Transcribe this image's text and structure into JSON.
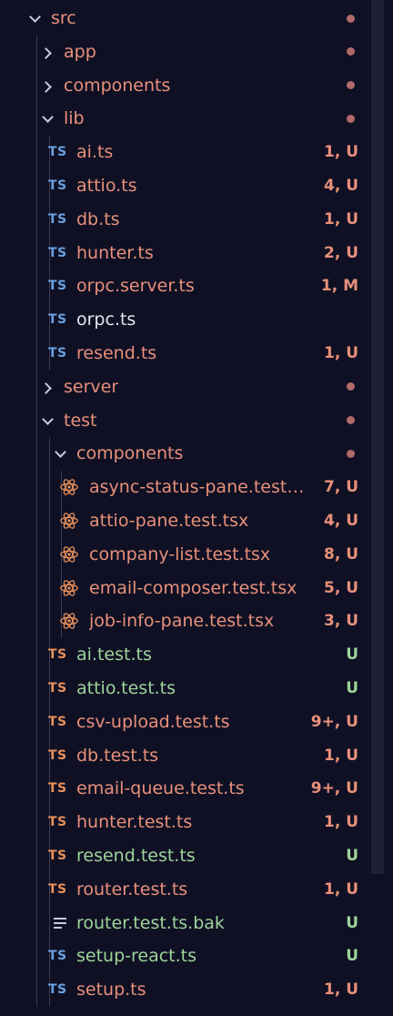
{
  "colors": {
    "modified_text": "#e8907a",
    "untracked_text": "#9ed49a",
    "plain_text": "#e6e6f0",
    "status_modified": "#e8907a",
    "status_untracked": "#9ed49a",
    "dot": "#b06a6a",
    "ts_blue": "#6aa0e0",
    "ts_orange": "#e8905a"
  },
  "tree": [
    {
      "name": "src",
      "depth": 0,
      "type": "folder",
      "open": true,
      "dot": true,
      "tone": "mod"
    },
    {
      "name": "app",
      "depth": 1,
      "type": "folder",
      "open": false,
      "dot": true,
      "tone": "mod"
    },
    {
      "name": "components",
      "depth": 1,
      "type": "folder",
      "open": false,
      "dot": true,
      "tone": "mod"
    },
    {
      "name": "lib",
      "depth": 1,
      "type": "folder",
      "open": true,
      "dot": true,
      "tone": "mod"
    },
    {
      "name": "ai.ts",
      "depth": 2,
      "type": "ts",
      "status": "1, U",
      "tone": "mod"
    },
    {
      "name": "attio.ts",
      "depth": 2,
      "type": "ts",
      "status": "4, U",
      "tone": "mod"
    },
    {
      "name": "db.ts",
      "depth": 2,
      "type": "ts",
      "status": "1, U",
      "tone": "mod"
    },
    {
      "name": "hunter.ts",
      "depth": 2,
      "type": "ts",
      "status": "2, U",
      "tone": "mod"
    },
    {
      "name": "orpc.server.ts",
      "depth": 2,
      "type": "ts",
      "status": "1, M",
      "tone": "mod"
    },
    {
      "name": "orpc.ts",
      "depth": 2,
      "type": "ts",
      "status": "",
      "tone": "plain"
    },
    {
      "name": "resend.ts",
      "depth": 2,
      "type": "ts",
      "status": "1, U",
      "tone": "mod"
    },
    {
      "name": "server",
      "depth": 1,
      "type": "folder",
      "open": false,
      "dot": true,
      "tone": "mod"
    },
    {
      "name": "test",
      "depth": 1,
      "type": "folder",
      "open": true,
      "dot": true,
      "tone": "mod"
    },
    {
      "name": "components",
      "depth": 2,
      "type": "folder",
      "open": true,
      "dot": true,
      "tone": "mod"
    },
    {
      "name": "async-status-pane.test…",
      "depth": 3,
      "type": "react",
      "status": "7, U",
      "tone": "mod"
    },
    {
      "name": "attio-pane.test.tsx",
      "depth": 3,
      "type": "react",
      "status": "4, U",
      "tone": "mod"
    },
    {
      "name": "company-list.test.tsx",
      "depth": 3,
      "type": "react",
      "status": "8, U",
      "tone": "mod"
    },
    {
      "name": "email-composer.test.tsx",
      "depth": 3,
      "type": "react",
      "status": "5, U",
      "tone": "mod"
    },
    {
      "name": "job-info-pane.test.tsx",
      "depth": 3,
      "type": "react",
      "status": "3, U",
      "tone": "mod"
    },
    {
      "name": "ai.test.ts",
      "depth": 2,
      "type": "ts-orange",
      "status": "U",
      "tone": "untracked"
    },
    {
      "name": "attio.test.ts",
      "depth": 2,
      "type": "ts-orange",
      "status": "U",
      "tone": "untracked"
    },
    {
      "name": "csv-upload.test.ts",
      "depth": 2,
      "type": "ts-orange",
      "status": "9+, U",
      "tone": "mod"
    },
    {
      "name": "db.test.ts",
      "depth": 2,
      "type": "ts-orange",
      "status": "1, U",
      "tone": "mod"
    },
    {
      "name": "email-queue.test.ts",
      "depth": 2,
      "type": "ts-orange",
      "status": "9+, U",
      "tone": "mod"
    },
    {
      "name": "hunter.test.ts",
      "depth": 2,
      "type": "ts-orange",
      "status": "1, U",
      "tone": "mod"
    },
    {
      "name": "resend.test.ts",
      "depth": 2,
      "type": "ts-orange",
      "status": "U",
      "tone": "untracked"
    },
    {
      "name": "router.test.ts",
      "depth": 2,
      "type": "ts-orange",
      "status": "1, U",
      "tone": "mod"
    },
    {
      "name": "router.test.ts.bak",
      "depth": 2,
      "type": "text",
      "status": "U",
      "tone": "untracked"
    },
    {
      "name": "setup-react.ts",
      "depth": 2,
      "type": "ts",
      "status": "U",
      "tone": "untracked"
    },
    {
      "name": "setup.ts",
      "depth": 2,
      "type": "ts",
      "status": "1, U",
      "tone": "mod"
    }
  ],
  "icon_labels": {
    "ts": "TS"
  }
}
